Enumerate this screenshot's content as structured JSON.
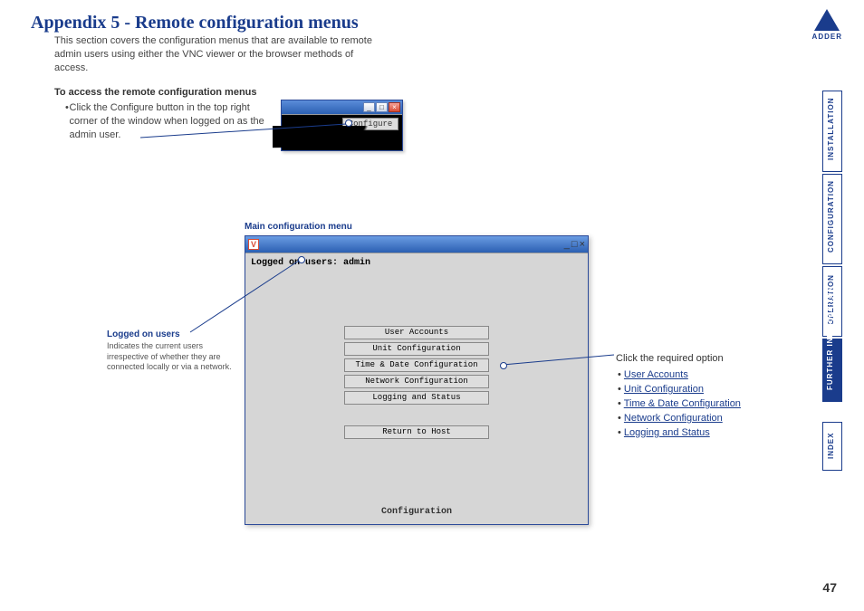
{
  "title": "Appendix 5 - Remote configuration menus",
  "intro": "This section covers the configuration menus that are available to remote admin users using either the VNC viewer or the browser methods of access.",
  "access_head": "To access the remote configuration menus",
  "access_item": "Click the Configure button in the top right corner of the window when logged on as the admin user.",
  "small_window": {
    "configure_label": "Configure"
  },
  "main_menu_label": "Main configuration menu",
  "big_window": {
    "logged_on": "Logged on users: admin",
    "buttons": [
      "User Accounts",
      "Unit Configuration",
      "Time & Date Configuration",
      "Network Configuration",
      "Logging and Status"
    ],
    "return_btn": "Return to Host",
    "footer": "Configuration",
    "vnc_icon": "V"
  },
  "anno_logged": {
    "head": "Logged on users",
    "text": "Indicates the current users irrespective of whether they are connected locally or via a network."
  },
  "right_anno": {
    "lead": "Click the required option",
    "links": [
      "User Accounts",
      "Unit Configuration",
      "Time & Date Configuration",
      "Network Configuration",
      "Logging and Status"
    ]
  },
  "sidenav": {
    "installation": "INSTALLATION",
    "configuration": "CONFIGURATION",
    "operation": "OPERATION",
    "further1": "FURTHER",
    "further2": "INFORMATION",
    "index": "INDEX",
    "index_gap": " "
  },
  "logo": "ADDER",
  "page_num": "47",
  "tb": {
    "min": "_",
    "max": "□",
    "close": "×"
  }
}
